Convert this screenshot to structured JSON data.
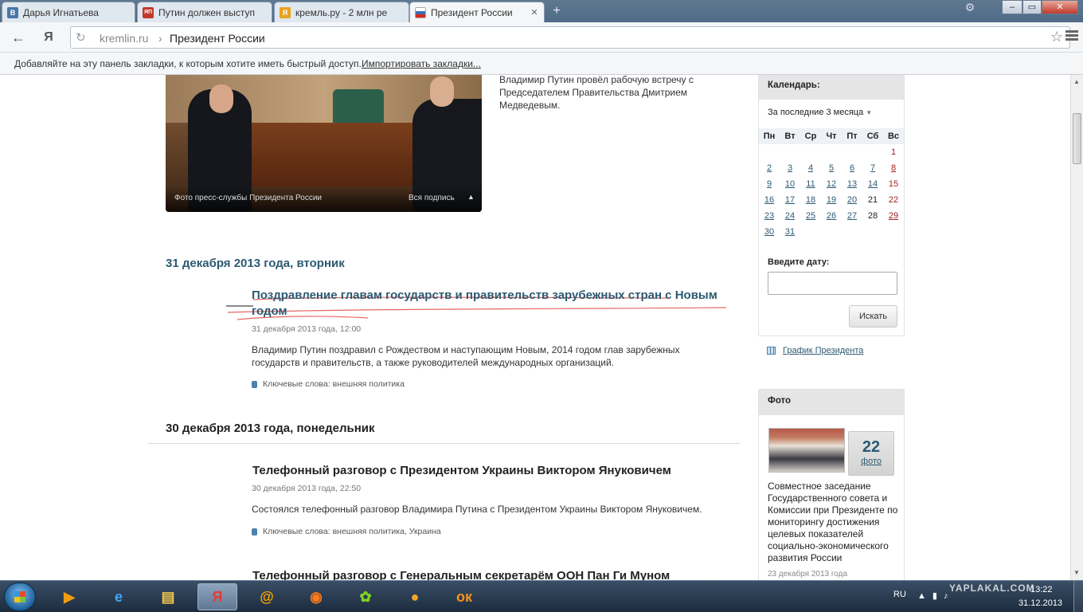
{
  "browser": {
    "tabs": [
      {
        "label": "Дарья Игнатьева",
        "icon": "vk-icon",
        "color": "#4a76a8",
        "glyph": "В"
      },
      {
        "label": "Путин должен выступ",
        "icon": "yaplakal-icon",
        "color": "#c0392b",
        "glyph": "ЯП"
      },
      {
        "label": "кремль.ру - 2 млн ре",
        "icon": "yandex-search-icon",
        "color": "#e8a320",
        "glyph": "Я"
      },
      {
        "label": "Президент России",
        "icon": "russia-flag-icon",
        "color": "#3b6fb6",
        "glyph": ""
      }
    ],
    "url_host": "kremlin.ru",
    "url_separator": "›",
    "url_title": "Президент России",
    "back_glyph": "←",
    "yandex_glyph": "Я",
    "bookmarks_hint": "Добавляйте на эту панель закладки, к которым хотите иметь быстрый доступ.",
    "bookmarks_import": "Импортировать закладки..."
  },
  "photo": {
    "credit": "Фото пресс-службы Президента России",
    "caption_toggle": "Вся подпись",
    "description": "Владимир Путин провёл рабочую встречу с Председателем Правительства Дмитрием Медведевым."
  },
  "days": [
    {
      "heading": "31 декабря 2013 года, вторник",
      "news": [
        {
          "title": "Поздравление главам государств и правительств зарубежных стран с Новым годом",
          "date": "31 декабря 2013 года, 12:00",
          "text": "Владимир Путин поздравил с Рождеством и наступающим Новым, 2014 годом глав зарубежных государств и правительств, а также руководителей международных организаций.",
          "tags_label": "Ключевые слова:",
          "tags": "внешняя политика"
        }
      ]
    },
    {
      "heading": "30 декабря 2013 года, понедельник",
      "news": [
        {
          "title": "Телефонный разговор с Президентом Украины Виктором Януковичем",
          "date": "30 декабря 2013 года, 22:50",
          "text": "Состоялся телефонный разговор Владимира Путина с Президентом Украины Виктором Януковичем.",
          "tags_label": "Ключевые слова:",
          "tags": "внешняя политика, Украина"
        },
        {
          "title": "Телефонный разговор с Генеральным секретарём ООН Пан Ги Муном"
        }
      ]
    }
  ],
  "calendar": {
    "title": "Календарь:",
    "period": "За последние 3 месяца",
    "weekdays": [
      "Пн",
      "Вт",
      "Ср",
      "Чт",
      "Пт",
      "Сб",
      "Вс"
    ],
    "weeks": [
      [
        "",
        "",
        "",
        "",
        "",
        "",
        "1"
      ],
      [
        "2",
        "3",
        "4",
        "5",
        "6",
        "7",
        "8"
      ],
      [
        "9",
        "10",
        "11",
        "12",
        "13",
        "14",
        "15"
      ],
      [
        "16",
        "17",
        "18",
        "19",
        "20",
        "21",
        "22"
      ],
      [
        "23",
        "24",
        "25",
        "26",
        "27",
        "28",
        "29"
      ],
      [
        "30",
        "31",
        "",
        "",
        "",
        "",
        ""
      ]
    ],
    "date_label": "Введите дату:",
    "date_value": "",
    "search_button": "Искать",
    "schedule_link": "График Президента"
  },
  "photo_block": {
    "title": "Фото",
    "count": "22",
    "count_unit": "фото",
    "description": "Совместное заседание Государственного совета и Комиссии при Президенте по мониторингу достижения целевых показателей социально-экономического развития России",
    "date": "23 декабря 2013 года"
  },
  "taskbar": {
    "apps": [
      {
        "name": "media-player-icon",
        "glyph": "▶",
        "color": "#f39c12"
      },
      {
        "name": "internet-explorer-icon",
        "glyph": "e",
        "color": "#3fa9f5"
      },
      {
        "name": "folder-icon",
        "glyph": "▤",
        "color": "#f2c94c"
      },
      {
        "name": "yandex-browser-icon",
        "glyph": "Я",
        "color": "#e53935"
      },
      {
        "name": "mail-agent-icon",
        "glyph": "@",
        "color": "#f7a600"
      },
      {
        "name": "firefox-icon",
        "glyph": "◉",
        "color": "#ff7a1a"
      },
      {
        "name": "icq-icon",
        "glyph": "✿",
        "color": "#7ed321"
      },
      {
        "name": "ball-app-icon",
        "glyph": "●",
        "color": "#f5a623"
      },
      {
        "name": "odnoklassniki-icon",
        "glyph": "ок",
        "color": "#f7931e"
      }
    ],
    "language": "RU",
    "time": "13:22",
    "date": "31.12.2013",
    "watermark": "YAPLAKAL.COM"
  }
}
